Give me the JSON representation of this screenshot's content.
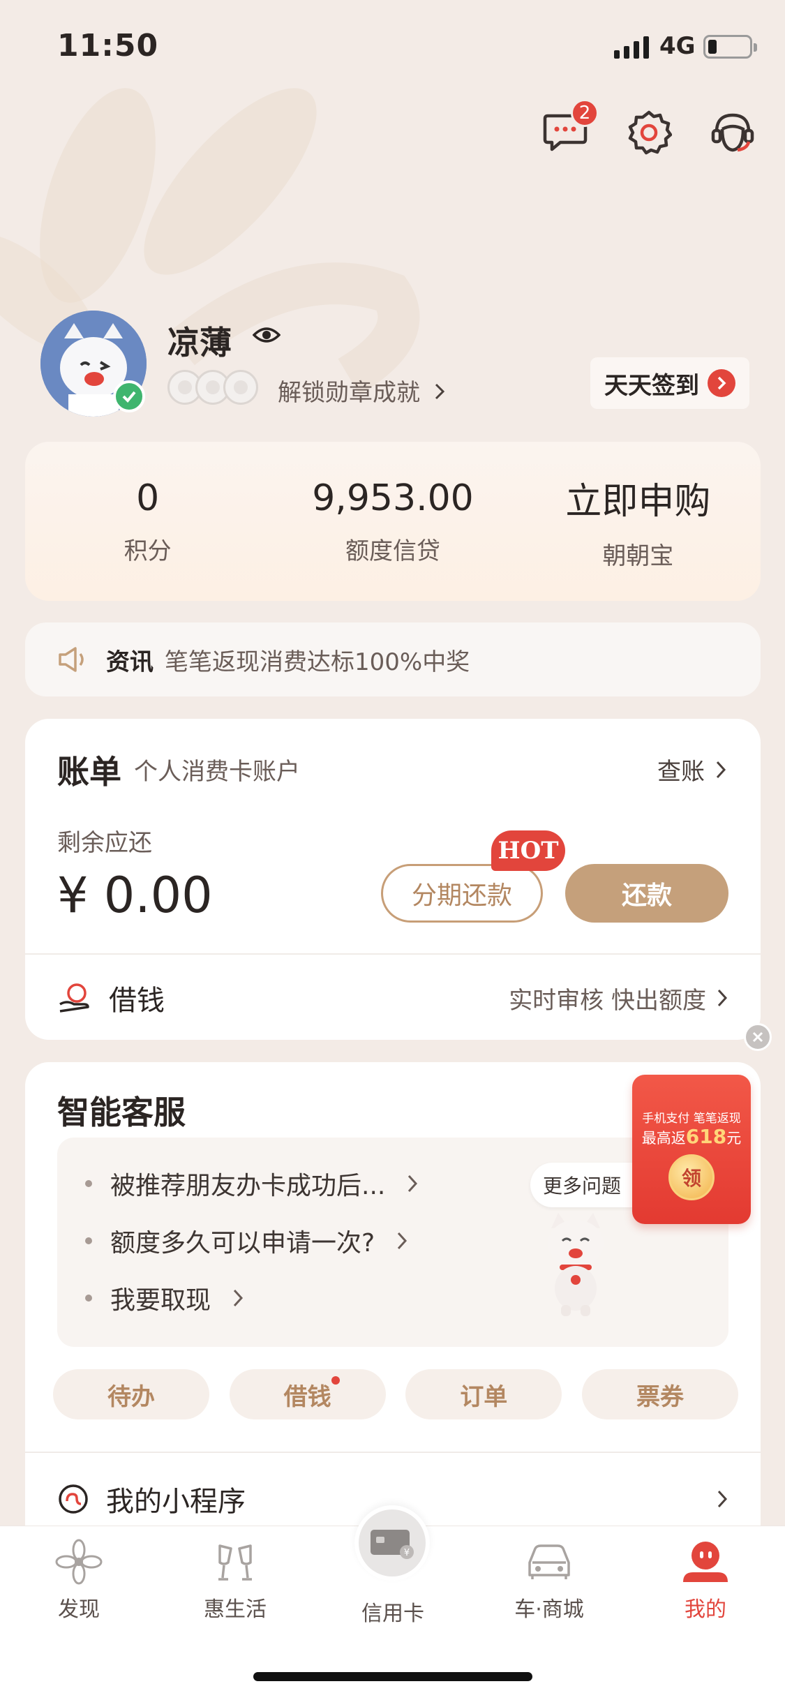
{
  "status_bar": {
    "time": "11:50",
    "network": "4G"
  },
  "header": {
    "message_badge": "2"
  },
  "profile": {
    "username": "凉薄",
    "medal_text": "解锁勋章成就",
    "signin_label": "天天签到"
  },
  "stats": [
    {
      "value": "0",
      "label": "积分"
    },
    {
      "value": "9,953.00",
      "label": "额度信贷"
    },
    {
      "value": "立即申购",
      "label": "朝朝宝"
    }
  ],
  "news": {
    "label": "资讯",
    "text": "笔笔返现消费达标100%中奖"
  },
  "bill": {
    "title": "账单",
    "subtitle": "个人消费卡账户",
    "check_label": "查账",
    "remain_label": "剩余应还",
    "amount": "¥ 0.00",
    "installment_label": "分期还款",
    "hot_tag": "HOT",
    "repay_label": "还款",
    "loan_label": "借钱",
    "loan_desc": "实时审核 快出额度"
  },
  "service": {
    "title": "智能客服",
    "questions": [
      "被推荐朋友办卡成功后...",
      "额度多久可以申请一次?",
      "我要取现"
    ],
    "more_label": "更多问题",
    "chips": [
      "待办",
      "借钱",
      "订单",
      "票券"
    ],
    "mini_program_label": "我的小程序"
  },
  "red_packet": {
    "line1": "手机支付 笔笔返现",
    "line2_prefix": "最高返",
    "line2_amount": "618",
    "line2_suffix": "元",
    "coin_label": "领"
  },
  "tabs": [
    {
      "label": "发现",
      "icon": "flower-icon"
    },
    {
      "label": "惠生活",
      "icon": "cheers-icon"
    },
    {
      "label": "信用卡",
      "icon": "credit-card-icon"
    },
    {
      "label": "车·商城",
      "icon": "car-icon"
    },
    {
      "label": "我的",
      "icon": "profile-face-icon",
      "active": true
    }
  ],
  "colors": {
    "background": "#f3ebe6",
    "accent_gold": "#c5a07b",
    "accent_red": "#e2453c"
  }
}
